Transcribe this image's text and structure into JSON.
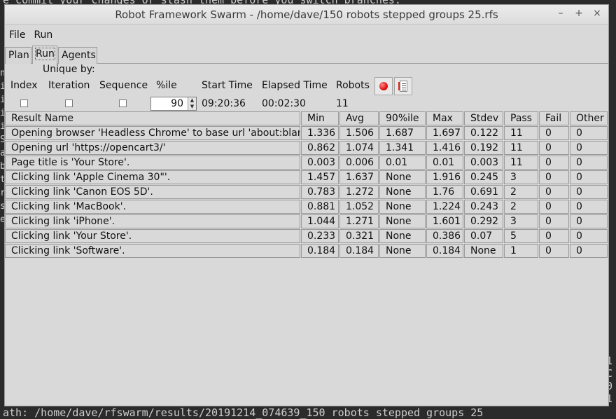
{
  "terminal": {
    "top_line": "e commit your changes or stash them before you switch branches.",
    "bottom_line": "ath: /home/dave/rfswarm/results/20191214_074639_150 robots stepped groups 25",
    "right_fragments": [
      "1",
      "C",
      "0",
      "1"
    ],
    "left_fragments": [
      "n",
      "i",
      "i",
      "i",
      "i",
      "S",
      "a",
      "b",
      "t",
      "r",
      "s",
      "e"
    ]
  },
  "window": {
    "title": "Robot Framework Swarm - /home/dave/150 robots stepped groups 25.rfs",
    "controls": {
      "minimize": "–",
      "maximize": "+",
      "close": "×"
    }
  },
  "menu": [
    "File",
    "Run"
  ],
  "tabs": [
    "Plan",
    "Run",
    "Agents"
  ],
  "active_tab": "Run",
  "run": {
    "unique_by_label": "Unique by:",
    "index_label": "Index",
    "iteration_label": "Iteration",
    "sequence_label": "Sequence",
    "percentile_label": "%ile",
    "percentile_value": "90",
    "start_time_label": "Start Time",
    "start_time": "09:20:36",
    "elapsed_label": "Elapsed Time",
    "elapsed": "00:02:30",
    "robots_label": "Robots",
    "robots": "11"
  },
  "table": {
    "headers": [
      "Result Name",
      "Min",
      "Avg",
      "90%ile",
      "Max",
      "Stdev",
      "Pass",
      "Fail",
      "Other"
    ],
    "rows": [
      [
        "Opening browser 'Headless Chrome' to base url 'about:blank'.",
        "1.336",
        "1.506",
        "1.687",
        "1.697",
        "0.122",
        "11",
        "0",
        "0"
      ],
      [
        "Opening url 'https://opencart3/'",
        "0.862",
        "1.074",
        "1.341",
        "1.416",
        "0.192",
        "11",
        "0",
        "0"
      ],
      [
        "Page title is 'Your Store'.",
        "0.003",
        "0.006",
        "0.01",
        "0.01",
        "0.003",
        "11",
        "0",
        "0"
      ],
      [
        "Clicking link 'Apple Cinema 30\"'.",
        "1.457",
        "1.637",
        "None",
        "1.916",
        "0.245",
        "3",
        "0",
        "0"
      ],
      [
        "Clicking link 'Canon EOS 5D'.",
        "0.783",
        "1.272",
        "None",
        "1.76",
        "0.691",
        "2",
        "0",
        "0"
      ],
      [
        "Clicking link 'MacBook'.",
        "0.881",
        "1.052",
        "None",
        "1.224",
        "0.243",
        "2",
        "0",
        "0"
      ],
      [
        "Clicking link 'iPhone'.",
        "1.044",
        "1.271",
        "None",
        "1.601",
        "0.292",
        "3",
        "0",
        "0"
      ],
      [
        "Clicking link 'Your Store'.",
        "0.233",
        "0.321",
        "None",
        "0.386",
        "0.07",
        "5",
        "0",
        "0"
      ],
      [
        "Clicking link 'Software'.",
        "0.184",
        "0.184",
        "None",
        "0.184",
        "None",
        "1",
        "0",
        "0"
      ]
    ]
  }
}
